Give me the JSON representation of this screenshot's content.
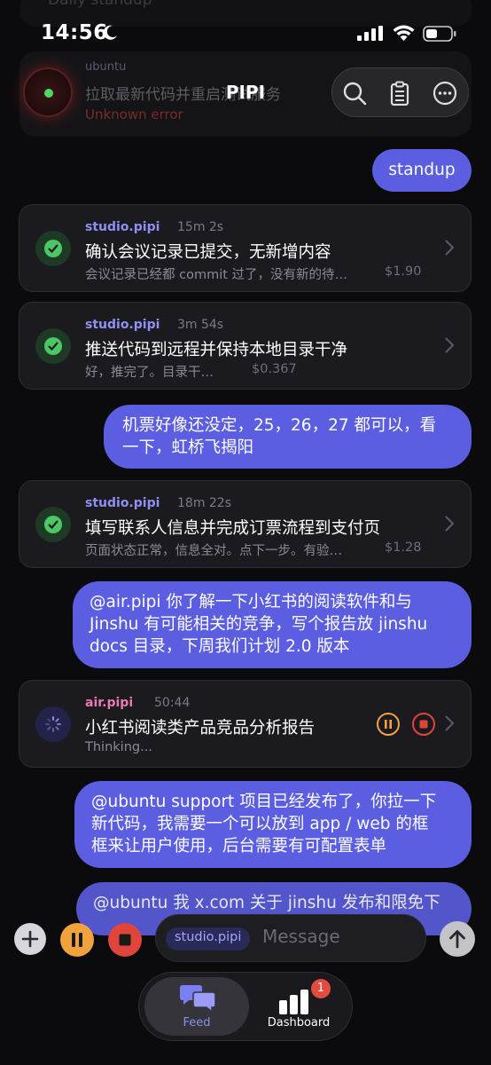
{
  "status_bar": {
    "time": "14:56"
  },
  "background": {
    "top_ghost_text": "Daily standup",
    "ghost_agent": "ubuntu",
    "ghost_title": "拉取最新代码并重启测试服务",
    "ghost_error": "Unknown error"
  },
  "header": {
    "title": "PIPI"
  },
  "messages": [
    {
      "type": "user",
      "text": "standup"
    },
    {
      "type": "task",
      "agent": "studio.pipi",
      "duration": "15m 2s",
      "title": "确认会议记录已提交，无新增内容",
      "summary": "会议记录已经都 commit 过了，没有新的待…",
      "cost": "$1.90",
      "state": "done"
    },
    {
      "type": "task",
      "agent": "studio.pipi",
      "duration": "3m 54s",
      "title": "推送代码到远程并保持本地目录干净",
      "summary": "好，推完了。目录干…",
      "cost": "$0.367",
      "state": "done"
    },
    {
      "type": "user",
      "line1": "机票好像还没定，25，26，27 都可以，看",
      "line2": "一下，虹桥飞揭阳"
    },
    {
      "type": "task",
      "agent": "studio.pipi",
      "duration": "18m 22s",
      "title": "填写联系人信息并完成订票流程到支付页",
      "summary": "页面状态正常，信息全对。点下一步。有验…",
      "cost": "$1.28",
      "state": "done"
    },
    {
      "type": "user",
      "line1": "@air.pipi 你了解一下小红书的阅读软件和与",
      "line2": "Jinshu 有可能相关的竞争，写个报告放 jinshu",
      "line3": "docs 目录，下周我们计划 2.0 版本"
    },
    {
      "type": "task",
      "agent": "air.pipi",
      "duration": "50:44",
      "title": "小红书阅读类产品竞品分析报告",
      "summary": "Thinking...",
      "state": "running"
    },
    {
      "type": "user",
      "line1": "@ubuntu support 项目已经发布了，你拉一下",
      "line2": "新代码，我需要一个可以放到 app / web 的框",
      "line3": "框来让用户使用，后台需要有可配置表单"
    },
    {
      "type": "user",
      "line1": "@ubuntu 我 x.com 关于 jinshu 发布和限免下"
    }
  ],
  "composer": {
    "target_chip": "studio.pipi",
    "placeholder": "Message"
  },
  "tabbar": {
    "feed_label": "Feed",
    "dashboard_label": "Dashboard",
    "dashboard_badge": "1"
  },
  "colors": {
    "accent": "#5b5ee0",
    "agent_label": "#8f8ff5",
    "agent_label_air": "#e87ab0",
    "success": "#4cc765",
    "pause": "#f0a23c",
    "stop": "#e0453c"
  }
}
